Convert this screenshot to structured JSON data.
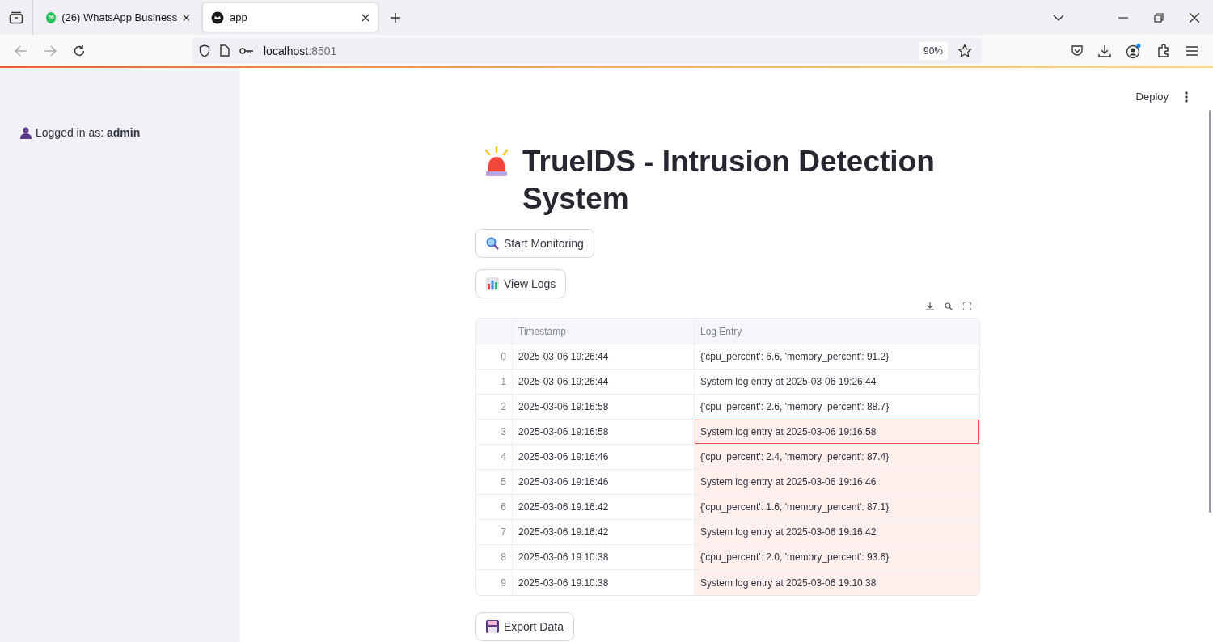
{
  "browser": {
    "tabs": [
      {
        "title": "(26) WhatsApp Business",
        "badge": "26",
        "kind": "whatsapp",
        "selected": false
      },
      {
        "title": "app",
        "kind": "streamlit",
        "selected": true
      }
    ],
    "url": {
      "host": "localhost",
      "port": ":8501"
    },
    "zoom": "90%"
  },
  "sidebar": {
    "login_text": "Logged in as: **admin**"
  },
  "header": {
    "deploy": "Deploy"
  },
  "title": "TrueIDS - Intrusion Detection System",
  "buttons": [
    {
      "label": "Start Monitoring",
      "kind": "search"
    },
    {
      "label": "View Logs",
      "kind": "chart"
    }
  ],
  "table": {
    "columns": [
      "Timestamp",
      "Log Entry"
    ],
    "rows": [
      {
        "index": "0",
        "timestamp": "2025-03-06 19:26:44",
        "entry": "{'cpu_percent': 6.6, 'memory_percent': 91.2}",
        "selected": false,
        "focused": false
      },
      {
        "index": "1",
        "timestamp": "2025-03-06 19:26:44",
        "entry": "System log entry at 2025-03-06 19:26:44",
        "selected": false,
        "focused": false
      },
      {
        "index": "2",
        "timestamp": "2025-03-06 19:16:58",
        "entry": "{'cpu_percent': 2.6, 'memory_percent': 88.7}",
        "selected": false,
        "focused": false
      },
      {
        "index": "3",
        "timestamp": "2025-03-06 19:16:58",
        "entry": "System log entry at 2025-03-06 19:16:58",
        "selected": true,
        "focused": true
      },
      {
        "index": "4",
        "timestamp": "2025-03-06 19:16:46",
        "entry": "{'cpu_percent': 2.4, 'memory_percent': 87.4}",
        "selected": true,
        "focused": false
      },
      {
        "index": "5",
        "timestamp": "2025-03-06 19:16:46",
        "entry": "System log entry at 2025-03-06 19:16:46",
        "selected": true,
        "focused": false
      },
      {
        "index": "6",
        "timestamp": "2025-03-06 19:16:42",
        "entry": "{'cpu_percent': 1.6, 'memory_percent': 87.1}",
        "selected": true,
        "focused": false
      },
      {
        "index": "7",
        "timestamp": "2025-03-06 19:16:42",
        "entry": "System log entry at 2025-03-06 19:16:42",
        "selected": true,
        "focused": false
      },
      {
        "index": "8",
        "timestamp": "2025-03-06 19:10:38",
        "entry": "{'cpu_percent': 2.0, 'memory_percent': 93.6}",
        "selected": true,
        "focused": false
      },
      {
        "index": "9",
        "timestamp": "2025-03-06 19:10:38",
        "entry": "System log entry at 2025-03-06 19:10:38",
        "selected": true,
        "focused": false
      }
    ]
  },
  "export_button": {
    "label": "Export Data"
  }
}
